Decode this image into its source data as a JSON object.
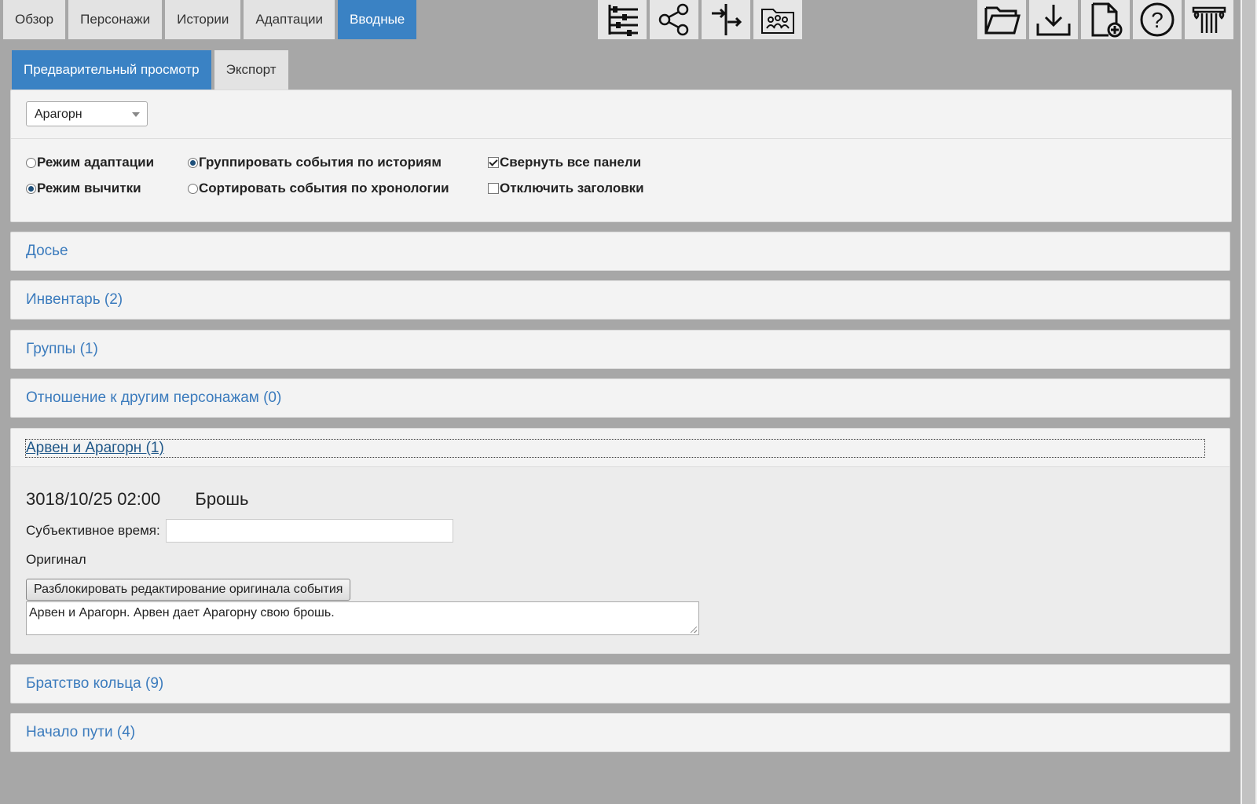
{
  "nav": {
    "tabs": [
      {
        "label": "Обзор"
      },
      {
        "label": "Персонажи"
      },
      {
        "label": "Истории"
      },
      {
        "label": "Адаптации"
      },
      {
        "label": "Вводные"
      }
    ],
    "active_tab": "Вводные"
  },
  "toolbar_center": [
    "timeline-icon",
    "share-network-icon",
    "arrows-split-icon",
    "group-folder-icon"
  ],
  "toolbar_right": [
    "folder-open-icon",
    "download-icon",
    "new-file-icon",
    "help-icon",
    "column-logo-icon"
  ],
  "subtabs": [
    {
      "label": "Предварительный просмотр"
    },
    {
      "label": "Экспорт"
    }
  ],
  "settings": {
    "character_select": "Арагорн",
    "options": {
      "adaptation_mode": "Режим адаптации",
      "proofread_mode": "Режим вычитки",
      "group_by_stories": "Группировать события по историям",
      "sort_chronology": "Сортировать события по хронологии",
      "collapse_panels": "Свернуть все панели",
      "disable_headers": "Отключить заголовки"
    },
    "state": {
      "mode": "proofread",
      "grouping": "stories",
      "collapse_panels": true,
      "disable_headers": false
    }
  },
  "panels": {
    "dossier": "Досье",
    "inventory": "Инвентарь (2)",
    "groups": "Группы (1)",
    "relations": "Отношение к другим персонажам (0)",
    "arwen": "Арвен и Арагорн (1)",
    "fellowship": "Братство кольца (9)",
    "journey": "Начало пути (4)"
  },
  "event": {
    "datetime": "3018/10/25 02:00",
    "name": "Брошь",
    "subjective_label": "Субъективное время:",
    "subjective_value": "",
    "original_label": "Оригинал",
    "unlock_button": "Разблокировать редактирование оригинала события",
    "original_text": "Арвен и Арагорн. Арвен дает Арагорну свою брошь."
  },
  "colors": {
    "accent": "#3a82c4",
    "background": "#a7a7a7",
    "panel": "#f3f3f3",
    "link": "#3b7bbd"
  }
}
